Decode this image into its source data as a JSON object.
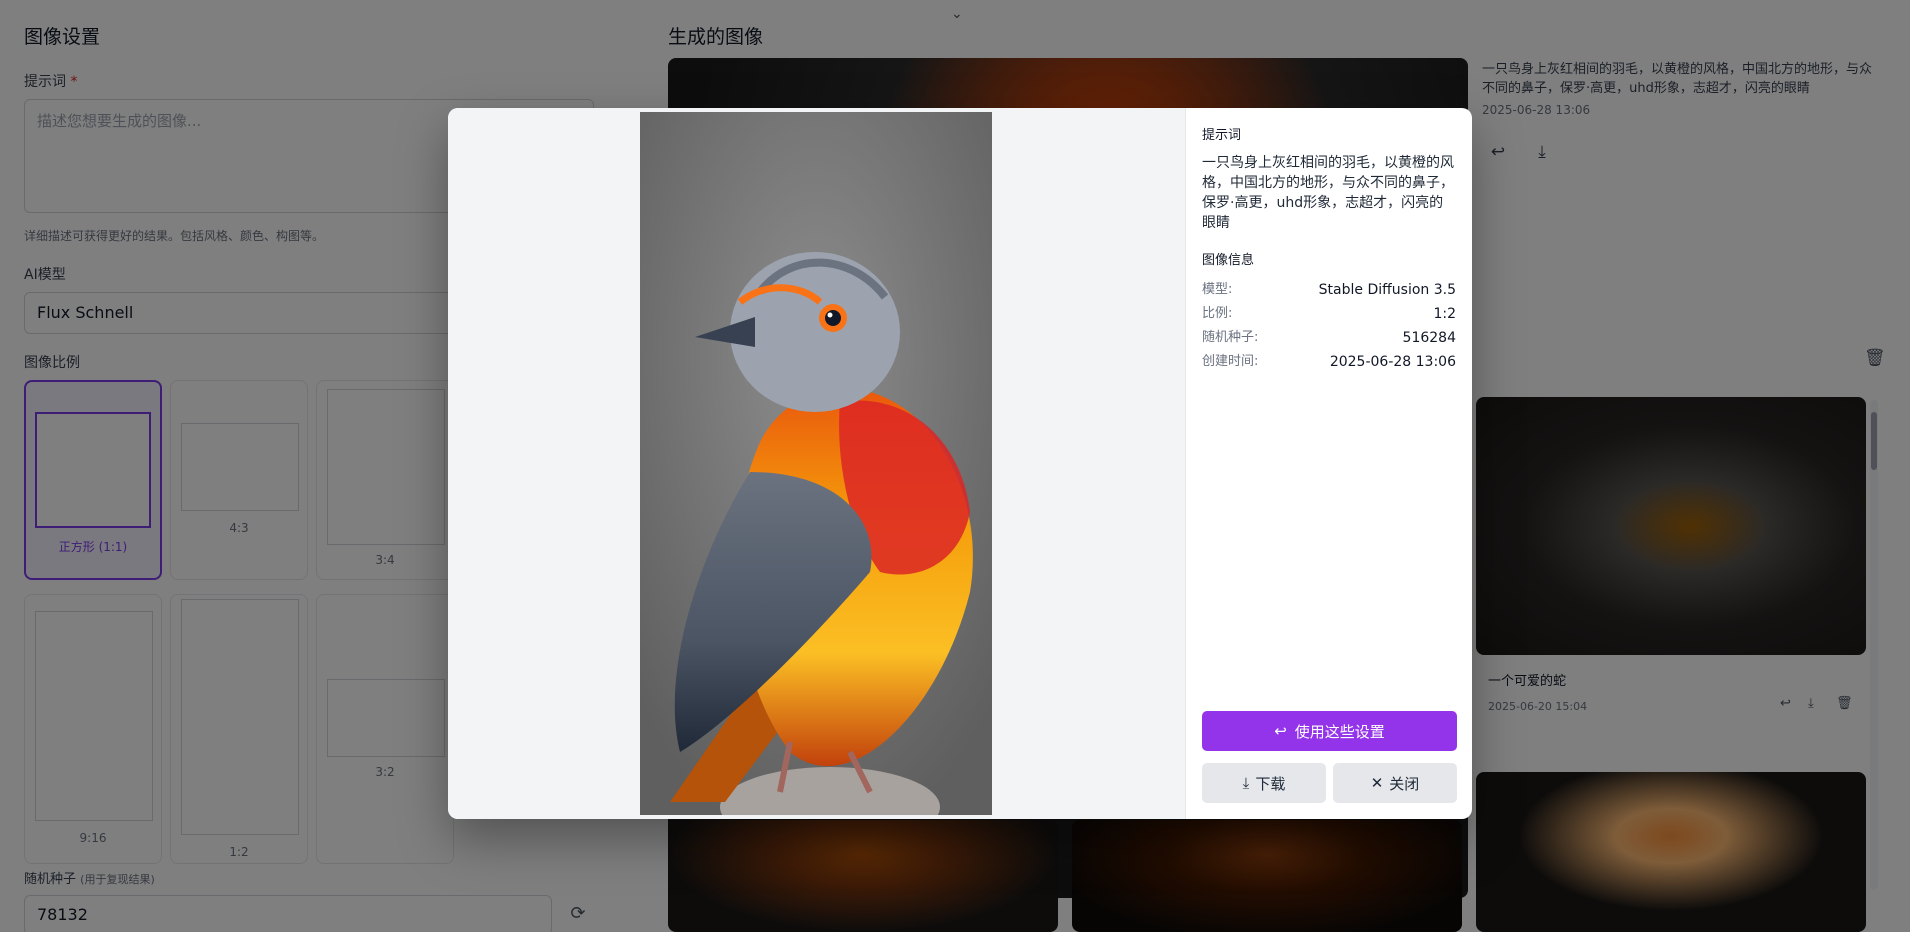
{
  "settings": {
    "title": "图像设置",
    "prompt_label": "提示词",
    "prompt_required": "*",
    "prompt_placeholder": "描述您想要生成的图像...",
    "prompt_hint": "详细描述可获得更好的结果。包括风格、颜色、构图等。",
    "model_label": "AI模型",
    "model_value": "Flux Schnell",
    "ratio_label": "图像比例",
    "ratios": [
      {
        "label": "正方形 (1:1)",
        "active": true
      },
      {
        "label": "4:3"
      },
      {
        "label": "3:4"
      },
      {
        "label": "9:16"
      },
      {
        "label": "1:2"
      },
      {
        "label": "3:2"
      }
    ],
    "seed_label": "随机种子",
    "seed_hint": "(用于复现结果)",
    "seed_value": "78132"
  },
  "gallery": {
    "title": "生成的图像",
    "featured": {
      "prompt": "一只鸟身上灰红相间的羽毛，以黄橙的风格，中国北方的地形，与众不同的鼻子，保罗·高更，uhd形象，志超才，闪亮的眼睛",
      "time": "2025-06-28 13:06"
    },
    "items": [
      {
        "title": "一个可爱的蛇",
        "time": "2025-06-20 15:04"
      }
    ]
  },
  "modal": {
    "prompt_heading": "提示词",
    "prompt_text": "一只鸟身上灰红相间的羽毛，以黄橙的风格，中国北方的地形，与众不同的鼻子，保罗·高更，uhd形象，志超才，闪亮的眼睛",
    "info_heading": "图像信息",
    "info": [
      {
        "key": "模型:",
        "value": "Stable Diffusion 3.5"
      },
      {
        "key": "比例:",
        "value": "1:2"
      },
      {
        "key": "随机种子:",
        "value": "516284"
      },
      {
        "key": "创建时间:",
        "value": "2025-06-28 13:06"
      }
    ],
    "use_settings_label": "使用这些设置",
    "download_label": "下载",
    "close_label": "关闭"
  },
  "colors": {
    "accent": "#9333ea",
    "overlay": "rgba(0,0,0,0.5)"
  }
}
